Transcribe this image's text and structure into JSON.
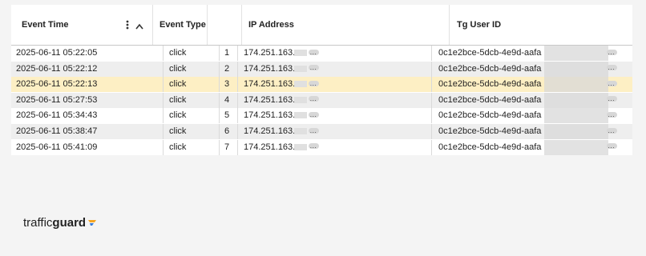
{
  "table": {
    "columns": [
      "Event Time",
      "Event Type",
      "",
      "IP Address",
      "Tg User ID"
    ],
    "rows": [
      {
        "time": "2025-06-11 05:22:05",
        "type": "click",
        "n": "1",
        "ip": "174.251.163.",
        "uid": "0c1e2bce-5dcb-4e9d-aafa"
      },
      {
        "time": "2025-06-11 05:22:12",
        "type": "click",
        "n": "2",
        "ip": "174.251.163.",
        "uid": "0c1e2bce-5dcb-4e9d-aafa"
      },
      {
        "time": "2025-06-11 05:22:13",
        "type": "click",
        "n": "3",
        "ip": "174.251.163.",
        "uid": "0c1e2bce-5dcb-4e9d-aafa"
      },
      {
        "time": "2025-06-11 05:27:53",
        "type": "click",
        "n": "4",
        "ip": "174.251.163.",
        "uid": "0c1e2bce-5dcb-4e9d-aafa"
      },
      {
        "time": "2025-06-11 05:34:43",
        "type": "click",
        "n": "5",
        "ip": "174.251.163.",
        "uid": "0c1e2bce-5dcb-4e9d-aafa"
      },
      {
        "time": "2025-06-11 05:38:47",
        "type": "click",
        "n": "6",
        "ip": "174.251.163.",
        "uid": "0c1e2bce-5dcb-4e9d-aafa"
      },
      {
        "time": "2025-06-11 05:41:09",
        "type": "click",
        "n": "7",
        "ip": "174.251.163.",
        "uid": "0c1e2bce-5dcb-4e9d-aafa"
      }
    ],
    "selected_row_index": 2,
    "colors": {
      "selected": "#fdefc4",
      "stripe": "#eeeeee"
    }
  },
  "header_icons": [
    "kebab-menu-icon",
    "sort-ascending-icon"
  ],
  "brand": {
    "prefix": "traffic",
    "bold": "guard",
    "mark_colors": [
      "#f5a623",
      "#3b7dd8"
    ]
  }
}
